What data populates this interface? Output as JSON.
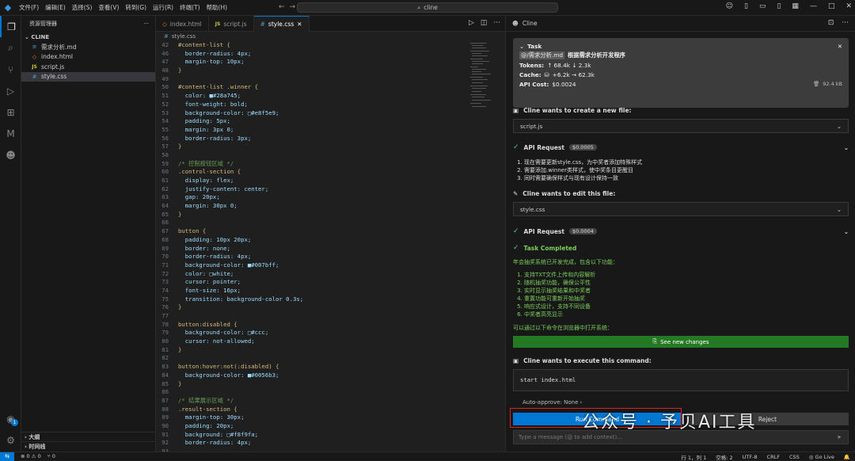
{
  "titlebar": {
    "menu": [
      "文件(F)",
      "编辑(E)",
      "选择(S)",
      "查看(V)",
      "转到(G)",
      "运行(R)",
      "终端(T)",
      "帮助(H)"
    ],
    "search": "cline"
  },
  "sidebar": {
    "title": "资源管理器",
    "folder": "CLINE",
    "files": [
      {
        "name": "需求分析.md",
        "icon": "md",
        "color": "#519aba"
      },
      {
        "name": "index.html",
        "icon": "html",
        "color": "#e37933"
      },
      {
        "name": "script.js",
        "icon": "JS",
        "color": "#cbcb41"
      },
      {
        "name": "style.css",
        "icon": "#",
        "color": "#519aba"
      }
    ],
    "outline": "大纲",
    "timeline": "时间线"
  },
  "editor": {
    "tabs": [
      {
        "label": "index.html",
        "icon": "<>",
        "color": "#e37933"
      },
      {
        "label": "script.js",
        "icon": "JS",
        "color": "#cbcb41"
      },
      {
        "label": "style.css",
        "icon": "#",
        "color": "#519aba"
      }
    ],
    "breadcrumb": "style.css",
    "crumb_icon": "#",
    "lines": [
      {
        "n": "42",
        "t": "#content-list {"
      },
      {
        "n": "46",
        "t": "  border-radius: 4px;"
      },
      {
        "n": "47",
        "t": "  margin-top: 10px;"
      },
      {
        "n": "48",
        "t": "}"
      },
      {
        "n": "49",
        "t": ""
      },
      {
        "n": "50",
        "t": "#content-list .winner {"
      },
      {
        "n": "51",
        "t": "  color: ■#28a745;"
      },
      {
        "n": "52",
        "t": "  font-weight: bold;"
      },
      {
        "n": "53",
        "t": "  background-color: □#e8f5e9;"
      },
      {
        "n": "54",
        "t": "  padding: 5px;"
      },
      {
        "n": "55",
        "t": "  margin: 3px 0;"
      },
      {
        "n": "56",
        "t": "  border-radius: 3px;"
      },
      {
        "n": "57",
        "t": "}"
      },
      {
        "n": "58",
        "t": ""
      },
      {
        "n": "59",
        "t": "/* 控制按钮区域 */"
      },
      {
        "n": "60",
        "t": ".control-section {"
      },
      {
        "n": "61",
        "t": "  display: flex;"
      },
      {
        "n": "62",
        "t": "  justify-content: center;"
      },
      {
        "n": "63",
        "t": "  gap: 20px;"
      },
      {
        "n": "64",
        "t": "  margin: 30px 0;"
      },
      {
        "n": "65",
        "t": "}"
      },
      {
        "n": "66",
        "t": ""
      },
      {
        "n": "67",
        "t": "button {"
      },
      {
        "n": "68",
        "t": "  padding: 10px 20px;"
      },
      {
        "n": "69",
        "t": "  border: none;"
      },
      {
        "n": "70",
        "t": "  border-radius: 4px;"
      },
      {
        "n": "71",
        "t": "  background-color: ■#007bff;"
      },
      {
        "n": "72",
        "t": "  color: □white;"
      },
      {
        "n": "73",
        "t": "  cursor: pointer;"
      },
      {
        "n": "74",
        "t": "  font-size: 16px;"
      },
      {
        "n": "75",
        "t": "  transition: background-color 0.3s;"
      },
      {
        "n": "76",
        "t": "}"
      },
      {
        "n": "77",
        "t": ""
      },
      {
        "n": "78",
        "t": "button:disabled {"
      },
      {
        "n": "79",
        "t": "  background-color: □#ccc;"
      },
      {
        "n": "80",
        "t": "  cursor: not-allowed;"
      },
      {
        "n": "81",
        "t": "}"
      },
      {
        "n": "82",
        "t": ""
      },
      {
        "n": "83",
        "t": "button:hover:not(:disabled) {"
      },
      {
        "n": "84",
        "t": "  background-color: ■#0056b3;"
      },
      {
        "n": "85",
        "t": "}"
      },
      {
        "n": "86",
        "t": ""
      },
      {
        "n": "87",
        "t": "/* 结果展示区域 */"
      },
      {
        "n": "88",
        "t": ".result-section {"
      },
      {
        "n": "89",
        "t": "  margin-top: 30px;"
      },
      {
        "n": "90",
        "t": "  padding: 20px;"
      },
      {
        "n": "91",
        "t": "  background: □#f8f9fa;"
      },
      {
        "n": "92",
        "t": "  border-radius: 4px;"
      },
      {
        "n": "93",
        "t": ""
      }
    ]
  },
  "cline": {
    "tab": "Cline",
    "task": {
      "label": "Task",
      "file": "@/需求分析.md",
      "desc": "根据需求分析开发程序",
      "tokens_label": "Tokens:",
      "tokens": "↑ 68.4k ↓ 2.3k",
      "cache_label": "Cache:",
      "cache": "+6.2k → 62.3k",
      "cost_label": "API Cost:",
      "cost": "$0.0024",
      "size": "92.4 kB"
    },
    "create_title": "Cline wants to create a new file:",
    "create_file": "script.js",
    "api1": {
      "label": "API Request",
      "cost": "$0.0005"
    },
    "api1_items": [
      "现在需要更新style.css，为中奖者添加特殊样式",
      "需要添加.winner类样式，使中奖条目更醒目",
      "同时需要确保样式与现有设计保持一致"
    ],
    "edit_title": "Cline wants to edit this file:",
    "edit_file": "style.css",
    "api2": {
      "label": "API Request",
      "cost": "$0.0004"
    },
    "completed": "Task Completed",
    "summary": "年会抽奖系统已开发完成，包含以下功能：",
    "features": [
      "支持TXT文件上传和内容解析",
      "随机抽奖功能，确保公平性",
      "实时显示抽奖结果和中奖者",
      "重置功能可重新开始抽奖",
      "响应式设计，支持不同设备",
      "中奖者高亮显示"
    ],
    "open_hint": "可以通过以下命令在浏览器中打开系统：",
    "see_changes": "See new changes",
    "exec_title": "Cline wants to execute this command:",
    "command": "start index.html",
    "auto_approve": "Auto-approve: None",
    "run": "Run Command",
    "reject": "Reject",
    "placeholder": "Type a message (@ to add context)..."
  },
  "watermark": "公众号 · 予贝AI工具",
  "status": {
    "errors": "⊗ 0 ⚠ 0",
    "ports": "⑂ 0",
    "pos": "行 1，列 1",
    "spaces": "空格: 2",
    "enc": "UTF-8",
    "eol": "CRLF",
    "lang": "CSS",
    "golive": "Go Live"
  }
}
